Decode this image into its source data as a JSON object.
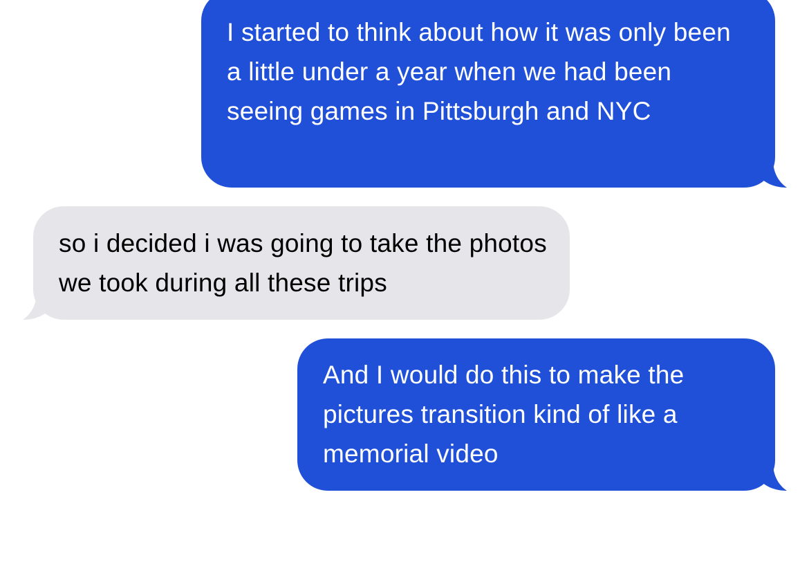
{
  "conversation": {
    "messages": [
      {
        "direction": "sent",
        "text": "I started to think about how it was only been a little under a year when we had been seeing games in Pittsburgh and NYC"
      },
      {
        "direction": "received",
        "text": "so i decided i was going to take the photos we took during all these trips"
      },
      {
        "direction": "sent",
        "text": "And I would do this to make the pictures transition kind of like a memorial video"
      }
    ]
  },
  "colors": {
    "sent_bubble": "#2150d8",
    "received_bubble": "#e5e5ea",
    "sent_text": "#ffffff",
    "received_text": "#000000",
    "background": "#ffffff"
  }
}
